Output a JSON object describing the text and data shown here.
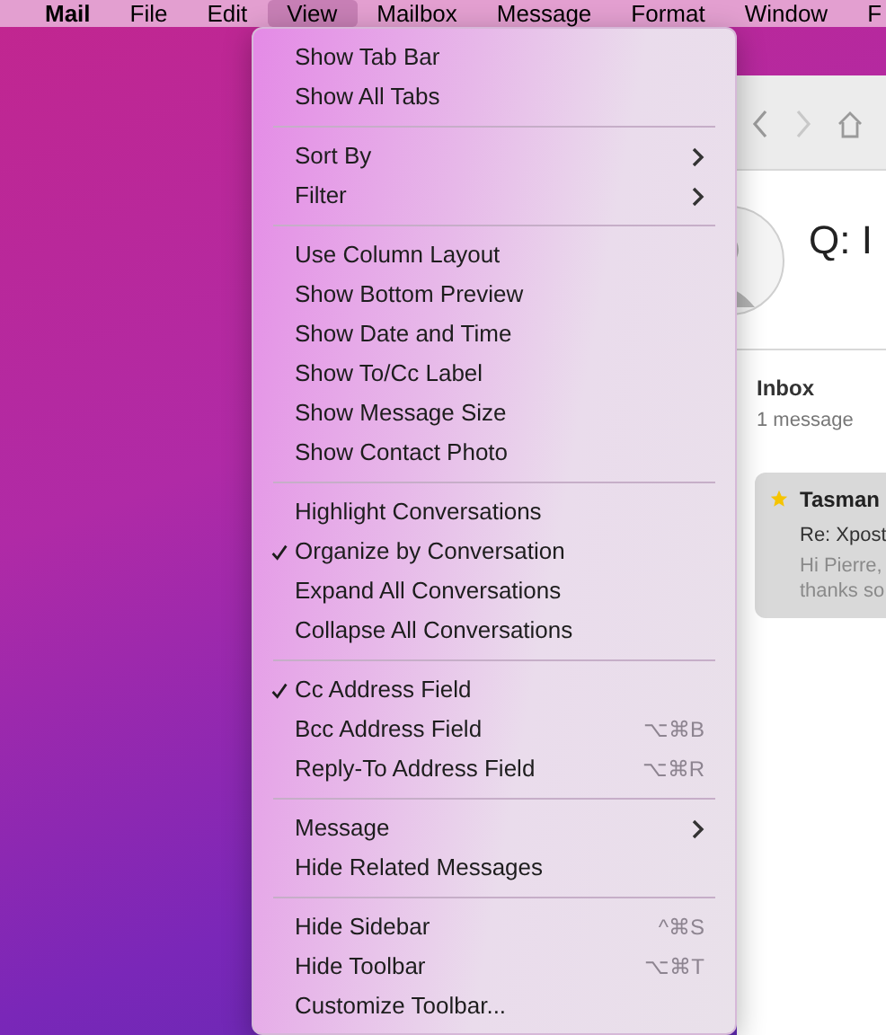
{
  "menu_bar": [
    {
      "label": "Mail",
      "selected": false
    },
    {
      "label": "File",
      "selected": false
    },
    {
      "label": "Edit",
      "selected": false
    },
    {
      "label": "View",
      "selected": true
    },
    {
      "label": "Mailbox",
      "selected": false
    },
    {
      "label": "Message",
      "selected": false
    },
    {
      "label": "Format",
      "selected": false
    },
    {
      "label": "Window",
      "selected": false
    },
    {
      "label": "F",
      "selected": false
    }
  ],
  "view_menu": {
    "sections": [
      [
        {
          "label": "Show Tab Bar",
          "checked": false,
          "has_submenu": false
        },
        {
          "label": "Show All Tabs",
          "checked": false,
          "has_submenu": false
        }
      ],
      [
        {
          "label": "Sort By",
          "checked": false,
          "has_submenu": true
        },
        {
          "label": "Filter",
          "checked": false,
          "has_submenu": true
        }
      ],
      [
        {
          "label": "Use Column Layout",
          "checked": false,
          "has_submenu": false
        },
        {
          "label": "Show Bottom Preview",
          "checked": false,
          "has_submenu": false
        },
        {
          "label": "Show Date and Time",
          "checked": false,
          "has_submenu": false
        },
        {
          "label": "Show To/Cc Label",
          "checked": false,
          "has_submenu": false
        },
        {
          "label": "Show Message Size",
          "checked": false,
          "has_submenu": false
        },
        {
          "label": "Show Contact Photo",
          "checked": false,
          "has_submenu": false
        }
      ],
      [
        {
          "label": "Highlight Conversations",
          "checked": false,
          "has_submenu": false
        },
        {
          "label": "Organize by Conversation",
          "checked": true,
          "has_submenu": false
        },
        {
          "label": "Expand All Conversations",
          "checked": false,
          "has_submenu": false
        },
        {
          "label": "Collapse All Conversations",
          "checked": false,
          "has_submenu": false
        }
      ],
      [
        {
          "label": "Cc Address Field",
          "checked": true,
          "has_submenu": false
        },
        {
          "label": "Bcc Address Field",
          "checked": false,
          "has_submenu": false,
          "shortcut": "⌥⌘B"
        },
        {
          "label": "Reply-To Address Field",
          "checked": false,
          "has_submenu": false,
          "shortcut": "⌥⌘R"
        }
      ],
      [
        {
          "label": "Message",
          "checked": false,
          "has_submenu": true
        },
        {
          "label": "Hide Related Messages",
          "checked": false,
          "has_submenu": false
        }
      ],
      [
        {
          "label": "Hide Sidebar",
          "checked": false,
          "has_submenu": false,
          "shortcut": "^⌘S"
        },
        {
          "label": "Hide Toolbar",
          "checked": false,
          "has_submenu": false,
          "shortcut": "⌥⌘T"
        },
        {
          "label": "Customize Toolbar...",
          "checked": false,
          "has_submenu": false
        }
      ]
    ]
  },
  "mail_window": {
    "header_title": "Q: I",
    "mailbox": {
      "title": "Inbox",
      "count": "1 message"
    },
    "messages": [
      {
        "sender": "Tasman",
        "subject": "Re: Xpost",
        "preview_lines": [
          "Hi Pierre,",
          "thanks so"
        ],
        "flagged": true,
        "selected": true
      }
    ]
  }
}
